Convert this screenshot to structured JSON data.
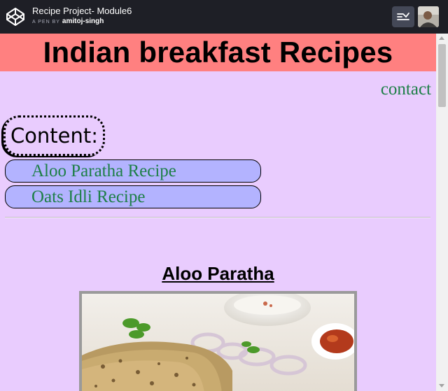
{
  "codepen": {
    "pen_title": "Recipe Project- Module6",
    "pen_by": "A PEN BY",
    "author": "amitoj-singh",
    "logo_icon": "codepen-logo-icon",
    "view_icon": "layout-toggle-icon"
  },
  "page": {
    "heading": "Indian breakfast Recipes",
    "contact_link": "contact",
    "content_label": "Content:",
    "toc": [
      {
        "label": "Aloo Paratha Recipe"
      },
      {
        "label": "Oats Idli Recipe"
      }
    ],
    "section_title": "Aloo Paratha",
    "image_subject": "aloo paratha with curd and pickle"
  },
  "colors": {
    "banner": "#ff8080",
    "page_background": "#e9ccfe",
    "toc_button": "#b3b3ff",
    "link": "#1e7f48",
    "header_background": "#1e1f26"
  }
}
